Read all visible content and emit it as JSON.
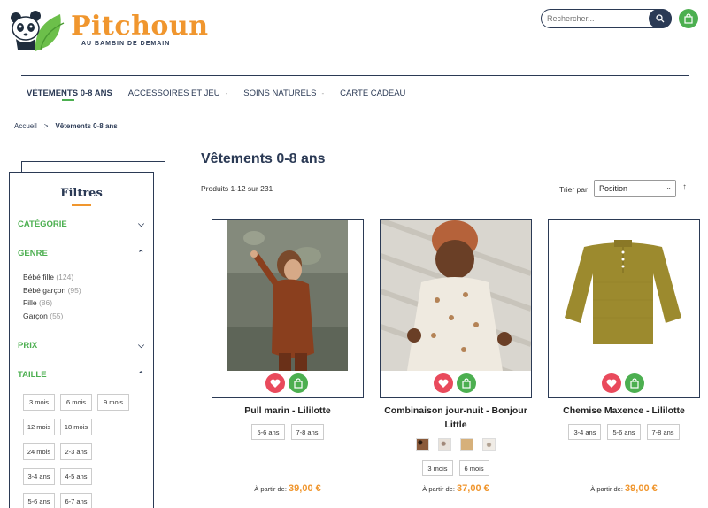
{
  "header": {
    "brand": "Pitchoun",
    "tagline": "AU BAMBIN DE DEMAIN",
    "search_placeholder": "Rechercher...",
    "colors": {
      "accent_green": "#4caf50",
      "brand_orange": "#f0962e",
      "navy": "#2b3a55",
      "wish_red": "#e94a5c"
    }
  },
  "nav": {
    "items": [
      {
        "label": "VÊTEMENTS 0-8 ANS",
        "active": true
      },
      {
        "label": "ACCESSOIRES ET JEU"
      },
      {
        "label": "SOINS NATURELS"
      },
      {
        "label": "CARTE CADEAU"
      }
    ],
    "dash": "-"
  },
  "breadcrumb": {
    "home": "Accueil",
    "separator": ">",
    "current": "Vêtements 0-8 ans"
  },
  "filters": {
    "title": "Filtres",
    "categorie": "CATÉGORIE",
    "genre": "GENRE",
    "genre_items": [
      {
        "label": "Bébé fille",
        "count": "(124)"
      },
      {
        "label": "Bébé garçon",
        "count": "(95)"
      },
      {
        "label": "Fille",
        "count": "(86)"
      },
      {
        "label": "Garçon",
        "count": "(55)"
      }
    ],
    "prix": "PRIX",
    "taille": "TAILLE",
    "sizes": [
      "3 mois",
      "6 mois",
      "9 mois",
      "12 mois",
      "18 mois",
      "24 mois",
      "2-3 ans",
      "3-4 ans",
      "4-5 ans",
      "5-6 ans",
      "6-7 ans"
    ]
  },
  "main": {
    "title": "Vêtements 0-8 ans",
    "count": "Produits 1-12 sur 231",
    "sort_label": "Trier par",
    "sort_value": "Position"
  },
  "products": [
    {
      "name": "Pull marin - Lililotte",
      "sizes": [
        "5-6 ans",
        "7-8 ans"
      ],
      "price_prefix": "À partir de:",
      "price": "39,00 €"
    },
    {
      "name": "Combinaison jour-nuit - Bonjour Little",
      "sizes": [
        "3 mois",
        "6 mois"
      ],
      "price_prefix": "À partir de:",
      "price": "37,00 €",
      "swatches": [
        "#8a5a3a",
        "#e8e2da",
        "#d6b07a",
        "#f0ece6"
      ]
    },
    {
      "name": "Chemise Maxence - Lililotte",
      "sizes": [
        "3-4 ans",
        "5-6 ans",
        "7-8 ans"
      ],
      "price_prefix": "À partir de:",
      "price": "39,00 €"
    }
  ]
}
